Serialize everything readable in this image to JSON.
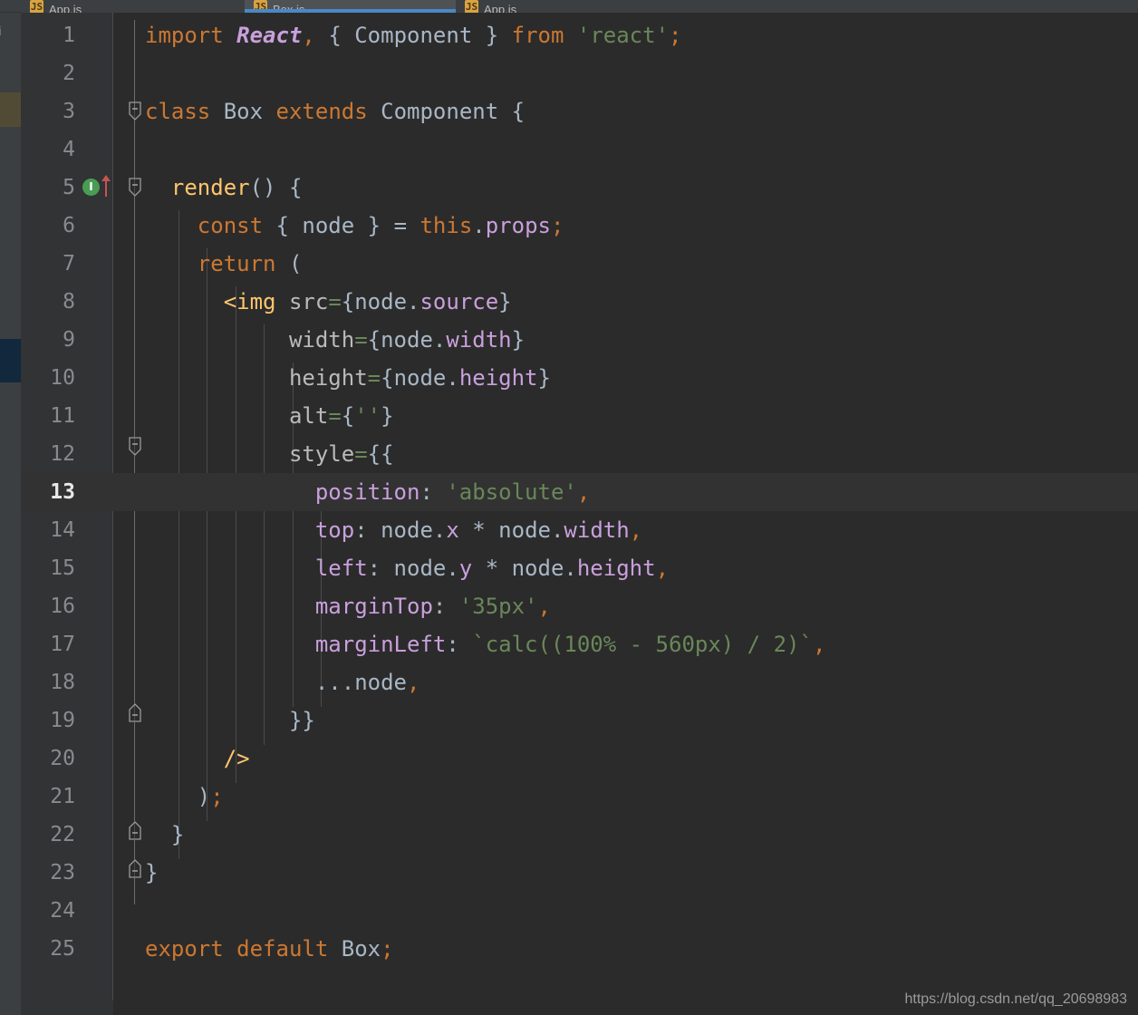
{
  "window": {
    "theme_name": "darcula",
    "background": "#2B2B2B",
    "gutter_background": "#313335",
    "accent": "#4A88C7"
  },
  "tabbar": {
    "tabs": [
      {
        "icon": "js-file-icon",
        "label": "App.js",
        "active": false
      },
      {
        "icon": "js-file-icon",
        "label": "Box.js",
        "active": true
      },
      {
        "icon": "js-file-icon",
        "label": "App.js",
        "active": false
      }
    ]
  },
  "project_strip": {
    "clipped_label": "ui",
    "markers": [
      {
        "name": "marker-olive",
        "color": "#514B35"
      },
      {
        "name": "marker-navy",
        "color": "#12283C"
      }
    ]
  },
  "gutter": {
    "run_icon_glyph": "I",
    "run_icon_color": "#499C54",
    "override_arrow_color": "#C75450",
    "current_line": 13
  },
  "editor": {
    "filename": "Box.js",
    "language": "JavaScript JSX",
    "lines": [
      {
        "n": "1",
        "indent": 0,
        "text": "import React, { Component } from 'react';"
      },
      {
        "n": "2",
        "indent": 0,
        "text": ""
      },
      {
        "n": "3",
        "indent": 0,
        "text": "class Box extends Component {"
      },
      {
        "n": "4",
        "indent": 0,
        "text": ""
      },
      {
        "n": "5",
        "indent": 1,
        "text": "render() {"
      },
      {
        "n": "6",
        "indent": 2,
        "text": "const { node } = this.props;"
      },
      {
        "n": "7",
        "indent": 2,
        "text": "return ("
      },
      {
        "n": "8",
        "indent": 3,
        "text": "<img src={node.source}"
      },
      {
        "n": "9",
        "indent": 5,
        "text": "width={node.width}"
      },
      {
        "n": "10",
        "indent": 5,
        "text": "height={node.height}"
      },
      {
        "n": "11",
        "indent": 5,
        "text": "alt={''}"
      },
      {
        "n": "12",
        "indent": 5,
        "text": "style={{"
      },
      {
        "n": "13",
        "indent": 6,
        "text": "position: 'absolute',"
      },
      {
        "n": "14",
        "indent": 6,
        "text": "top: node.x * node.width,"
      },
      {
        "n": "15",
        "indent": 6,
        "text": "left: node.y * node.height,"
      },
      {
        "n": "16",
        "indent": 6,
        "text": "marginTop: '35px',"
      },
      {
        "n": "17",
        "indent": 6,
        "text": "marginLeft: `calc((100% - 560px) / 2)`,"
      },
      {
        "n": "18",
        "indent": 6,
        "text": "...node,"
      },
      {
        "n": "19",
        "indent": 5,
        "text": "}}"
      },
      {
        "n": "20",
        "indent": 3,
        "text": "/>"
      },
      {
        "n": "21",
        "indent": 2,
        "text": ");"
      },
      {
        "n": "22",
        "indent": 1,
        "text": "}"
      },
      {
        "n": "23",
        "indent": 0,
        "text": "}"
      },
      {
        "n": "24",
        "indent": 0,
        "text": ""
      },
      {
        "n": "25",
        "indent": 0,
        "text": "export default Box;"
      }
    ]
  },
  "watermark": {
    "text": "https://blog.csdn.net/qq_20698983"
  }
}
